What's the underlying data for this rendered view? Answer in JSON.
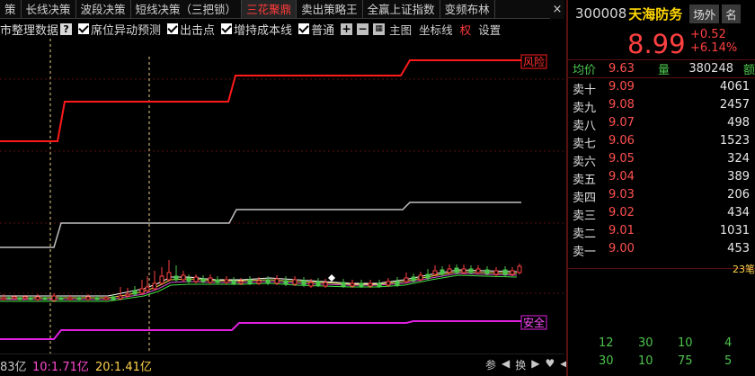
{
  "tabs": [
    {
      "label": "策",
      "active": false
    },
    {
      "label": "长线决策",
      "active": false
    },
    {
      "label": "波段决策",
      "active": false
    },
    {
      "label": "短线决策（三把锁）",
      "active": false
    },
    {
      "label": "三花聚鼎",
      "active": true
    },
    {
      "label": "卖出策略王",
      "active": false
    },
    {
      "label": "全赢上证指数",
      "active": false
    },
    {
      "label": "变频布林",
      "active": false
    }
  ],
  "tab_close": "×",
  "toolbar": {
    "market_label": "市整理数据",
    "help": "?",
    "opt1": "席位异动预测",
    "opt2": "出击点",
    "opt3": "增持成本线",
    "opt4": "普通",
    "main_chart": "主图",
    "coord_line": "坐标线",
    "weight": "权",
    "settings": "设置"
  },
  "chart_labels": {
    "risk": "风险",
    "safe": "安全"
  },
  "bottom": {
    "amount_prefix": "83亿",
    "ma10_label": "10:",
    "ma10_value": "1.71亿",
    "ma20_label": "20:",
    "ma20_value": "1.41亿",
    "nav_param": "参",
    "nav_swap": "换"
  },
  "stock": {
    "code": "300008",
    "name": "天海防务",
    "btn_market": "场外",
    "btn_other": "名",
    "price": "8.99",
    "change": "+0.52",
    "change_pct": "+6.14%",
    "avg_label": "均价",
    "avg_value": "9.63",
    "vol_label": "量",
    "vol_value": "380248",
    "extra_label": "额"
  },
  "asks": [
    {
      "label": "卖十",
      "price": "9.09",
      "vol": "4061"
    },
    {
      "label": "卖九",
      "price": "9.08",
      "vol": "2457"
    },
    {
      "label": "卖八",
      "price": "9.07",
      "vol": "498"
    },
    {
      "label": "卖七",
      "price": "9.06",
      "vol": "1523"
    },
    {
      "label": "卖六",
      "price": "9.05",
      "vol": "324"
    },
    {
      "label": "卖五",
      "price": "9.04",
      "vol": "389"
    },
    {
      "label": "卖四",
      "price": "9.03",
      "vol": "206"
    },
    {
      "label": "卖三",
      "price": "9.02",
      "vol": "434"
    },
    {
      "label": "卖二",
      "price": "9.01",
      "vol": "1031"
    },
    {
      "label": "卖一",
      "price": "9.00",
      "vol": "453"
    }
  ],
  "tick_count": "23笔",
  "green_rows": [
    [
      "12",
      "30",
      "10",
      "4"
    ],
    [
      "30",
      "10",
      "75",
      "5"
    ]
  ],
  "colors": {
    "up": "#ff4040",
    "down": "#4cc44c",
    "risk_line": "#ff1a1a",
    "safe_line": "#e020e0",
    "mid_line": "#c0c0c0",
    "active_tab": "#ff3a3a"
  }
}
